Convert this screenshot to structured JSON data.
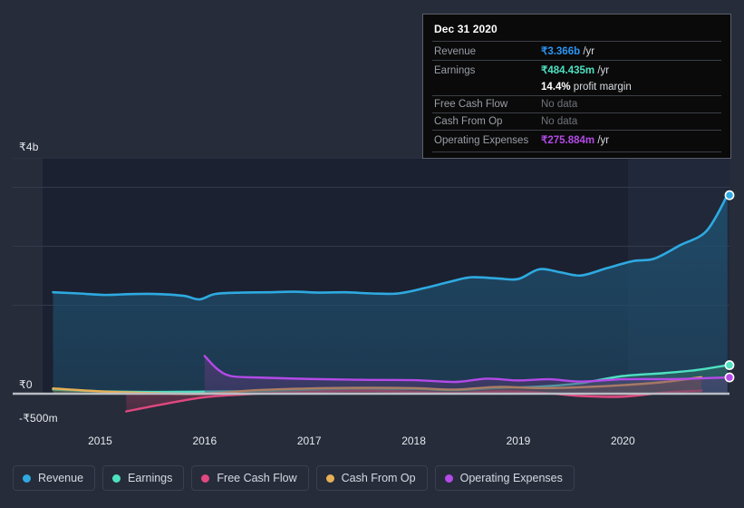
{
  "chart_data": {
    "type": "area",
    "title": "",
    "xlabel": "",
    "ylabel": "",
    "currency_symbol": "₹",
    "grid": true,
    "legend_position": "bottom",
    "x_tick_labels": [
      "2015",
      "2016",
      "2017",
      "2018",
      "2019",
      "2020"
    ],
    "y_tick_labels": [
      "₹4b",
      "₹0",
      "-₹500m"
    ],
    "ylim": [
      -500000000,
      4000000000
    ],
    "xlim": [
      "2014-06",
      "2021-03"
    ],
    "gridline_values": [
      4000000000,
      3500000000,
      2500000000,
      1500000000,
      0
    ],
    "series": [
      {
        "name": "Revenue",
        "color": "#2eaae1",
        "fill": "#1f4f6e",
        "points": [
          {
            "x": 2014.55,
            "y": 1720
          },
          {
            "x": 2014.8,
            "y": 1700
          },
          {
            "x": 2015.05,
            "y": 1675
          },
          {
            "x": 2015.3,
            "y": 1690
          },
          {
            "x": 2015.55,
            "y": 1690
          },
          {
            "x": 2015.8,
            "y": 1660
          },
          {
            "x": 2015.95,
            "y": 1600
          },
          {
            "x": 2016.1,
            "y": 1690
          },
          {
            "x": 2016.35,
            "y": 1715
          },
          {
            "x": 2016.6,
            "y": 1720
          },
          {
            "x": 2016.85,
            "y": 1730
          },
          {
            "x": 2017.1,
            "y": 1715
          },
          {
            "x": 2017.35,
            "y": 1720
          },
          {
            "x": 2017.6,
            "y": 1700
          },
          {
            "x": 2017.85,
            "y": 1700
          },
          {
            "x": 2018.1,
            "y": 1790
          },
          {
            "x": 2018.35,
            "y": 1900
          },
          {
            "x": 2018.55,
            "y": 1975
          },
          {
            "x": 2018.8,
            "y": 1955
          },
          {
            "x": 2019.0,
            "y": 1945
          },
          {
            "x": 2019.2,
            "y": 2110
          },
          {
            "x": 2019.4,
            "y": 2060
          },
          {
            "x": 2019.6,
            "y": 2005
          },
          {
            "x": 2019.85,
            "y": 2130
          },
          {
            "x": 2020.1,
            "y": 2250
          },
          {
            "x": 2020.3,
            "y": 2290
          },
          {
            "x": 2020.55,
            "y": 2520
          },
          {
            "x": 2020.8,
            "y": 2760
          },
          {
            "x": 2021.0,
            "y": 3366
          }
        ]
      },
      {
        "name": "Earnings",
        "color": "#4ee0c1",
        "fill": "#2d6f68",
        "points": [
          {
            "x": 2014.55,
            "y": 70
          },
          {
            "x": 2015.0,
            "y": 40
          },
          {
            "x": 2015.5,
            "y": 30
          },
          {
            "x": 2016.0,
            "y": 35
          },
          {
            "x": 2016.5,
            "y": 45
          },
          {
            "x": 2017.0,
            "y": 60
          },
          {
            "x": 2017.5,
            "y": 75
          },
          {
            "x": 2018.0,
            "y": 80
          },
          {
            "x": 2018.4,
            "y": 60
          },
          {
            "x": 2018.8,
            "y": 95
          },
          {
            "x": 2019.2,
            "y": 120
          },
          {
            "x": 2019.6,
            "y": 180
          },
          {
            "x": 2020.0,
            "y": 300
          },
          {
            "x": 2020.4,
            "y": 350
          },
          {
            "x": 2020.7,
            "y": 400
          },
          {
            "x": 2021.0,
            "y": 484
          }
        ]
      },
      {
        "name": "Free Cash Flow",
        "color": "#e0487f",
        "fill": "#7a3552",
        "points": [
          {
            "x": 2015.25,
            "y": -300
          },
          {
            "x": 2015.6,
            "y": -180
          },
          {
            "x": 2016.0,
            "y": -60
          },
          {
            "x": 2016.5,
            "y": 0
          },
          {
            "x": 2017.0,
            "y": 30
          },
          {
            "x": 2017.5,
            "y": 50
          },
          {
            "x": 2018.0,
            "y": 30
          },
          {
            "x": 2018.4,
            "y": 10
          },
          {
            "x": 2018.8,
            "y": 40
          },
          {
            "x": 2019.2,
            "y": 20
          },
          {
            "x": 2019.6,
            "y": -40
          },
          {
            "x": 2020.0,
            "y": -50
          },
          {
            "x": 2020.4,
            "y": 20
          },
          {
            "x": 2020.75,
            "y": 55
          }
        ]
      },
      {
        "name": "Cash From Op",
        "color": "#e8b055",
        "fill": "#7c6137",
        "points": [
          {
            "x": 2014.55,
            "y": 90
          },
          {
            "x": 2015.0,
            "y": 40
          },
          {
            "x": 2015.5,
            "y": 10
          },
          {
            "x": 2016.0,
            "y": 0
          },
          {
            "x": 2016.5,
            "y": 60
          },
          {
            "x": 2017.0,
            "y": 90
          },
          {
            "x": 2017.5,
            "y": 100
          },
          {
            "x": 2018.0,
            "y": 95
          },
          {
            "x": 2018.4,
            "y": 70
          },
          {
            "x": 2018.8,
            "y": 115
          },
          {
            "x": 2019.2,
            "y": 95
          },
          {
            "x": 2019.6,
            "y": 110
          },
          {
            "x": 2020.0,
            "y": 145
          },
          {
            "x": 2020.4,
            "y": 200
          },
          {
            "x": 2020.75,
            "y": 280
          }
        ]
      },
      {
        "name": "Operating Expenses",
        "color": "#b44ae8",
        "fill": "#5a3a7a",
        "points": [
          {
            "x": 2016.0,
            "y": 640
          },
          {
            "x": 2016.12,
            "y": 420
          },
          {
            "x": 2016.25,
            "y": 300
          },
          {
            "x": 2016.5,
            "y": 275
          },
          {
            "x": 2017.0,
            "y": 250
          },
          {
            "x": 2017.5,
            "y": 235
          },
          {
            "x": 2018.0,
            "y": 230
          },
          {
            "x": 2018.4,
            "y": 200
          },
          {
            "x": 2018.7,
            "y": 255
          },
          {
            "x": 2019.0,
            "y": 225
          },
          {
            "x": 2019.3,
            "y": 245
          },
          {
            "x": 2019.6,
            "y": 205
          },
          {
            "x": 2020.0,
            "y": 245
          },
          {
            "x": 2020.5,
            "y": 248
          },
          {
            "x": 2021.0,
            "y": 276
          }
        ]
      }
    ],
    "end_markers": [
      {
        "series": "Revenue",
        "color": "#2eaae1",
        "value": 3366
      },
      {
        "series": "Earnings",
        "color": "#4ee0c1",
        "value": 484
      },
      {
        "series": "Operating Expenses",
        "color": "#b44ae8",
        "value": 276
      }
    ]
  },
  "legend": {
    "items": [
      {
        "label": "Revenue",
        "color": "#2eaae1",
        "icon": "dot-icon"
      },
      {
        "label": "Earnings",
        "color": "#4ee0c1",
        "icon": "dot-icon"
      },
      {
        "label": "Free Cash Flow",
        "color": "#e0487f",
        "icon": "dot-icon"
      },
      {
        "label": "Cash From Op",
        "color": "#e8b055",
        "icon": "dot-icon"
      },
      {
        "label": "Operating Expenses",
        "color": "#b44ae8",
        "icon": "dot-icon"
      }
    ]
  },
  "tooltip": {
    "title": "Dec 31 2020",
    "rows": [
      {
        "key": "Revenue",
        "amount": "₹3.366b",
        "unit": "/yr",
        "color": "#2b95f5",
        "no_data": false
      },
      {
        "key": "Earnings",
        "amount": "₹484.435m",
        "unit": "/yr",
        "color": "#4ee0c1",
        "no_data": false
      },
      {
        "key": "",
        "amount": "14.4%",
        "unit": "profit margin",
        "color": "#ffffff",
        "no_data": false,
        "no_rule": true
      },
      {
        "key": "Free Cash Flow",
        "amount": "No data",
        "unit": "",
        "color": "#6f737c",
        "no_data": true
      },
      {
        "key": "Cash From Op",
        "amount": "No data",
        "unit": "",
        "color": "#6f737c",
        "no_data": true
      },
      {
        "key": "Operating Expenses",
        "amount": "₹275.884m",
        "unit": "/yr",
        "color": "#b44ae8",
        "no_data": false
      }
    ]
  },
  "colors": {
    "page_background": "#262c3a",
    "plot_background": "#1b2130",
    "forecast_band": "#1e2a3d",
    "gridline": "#333a4a",
    "zero_axis": "#b9bcc3",
    "tooltip_background": "#0a0a0a",
    "tooltip_border": "#5a5f6b"
  }
}
